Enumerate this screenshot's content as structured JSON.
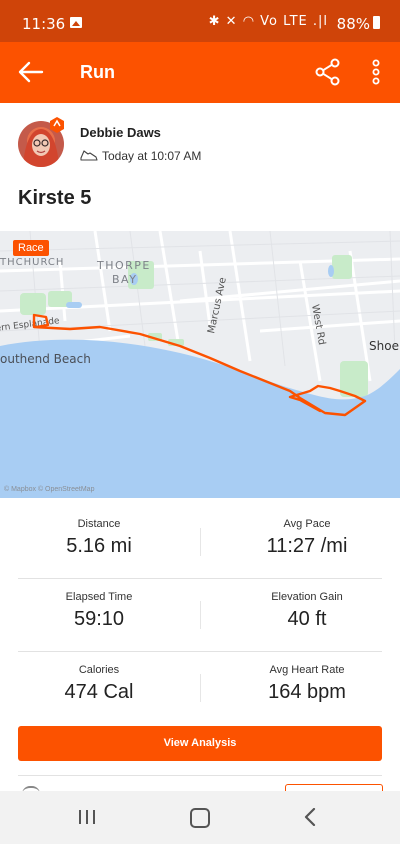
{
  "status_bar": {
    "time": "11:36",
    "icons": "✱ ✕ ◠ Vo LTE .|l",
    "battery": "88%"
  },
  "app_bar": {
    "title": "Run"
  },
  "athlete": {
    "name": "Debbie Daws",
    "time": "Today at 10:07 AM"
  },
  "activity": {
    "title": "Kirste 5"
  },
  "map": {
    "badge": "Race",
    "labels": {
      "thorpe_bay_1": "THORPE",
      "thorpe_bay_2": "BAY",
      "church": "THCHURCH",
      "marcus": "Marcus Ave",
      "west": "West Rd",
      "shoe": "Shoe",
      "esplanade": "ern Esplanade",
      "beach": "outhend Beach"
    },
    "attribution": "© Mapbox © OpenStreetMap"
  },
  "stats": [
    {
      "left": {
        "label": "Distance",
        "value": "5.16 mi"
      },
      "right": {
        "label": "Avg Pace",
        "value": "11:27 /mi"
      }
    },
    {
      "left": {
        "label": "Elapsed Time",
        "value": "59:10"
      },
      "right": {
        "label": "Elevation Gain",
        "value": "40 ft"
      }
    },
    {
      "left": {
        "label": "Calories",
        "value": "474 Cal"
      },
      "right": {
        "label": "Avg Heart Rate",
        "value": "164 bpm"
      }
    }
  ],
  "actions": {
    "view_analysis": "View Analysis"
  },
  "colors": {
    "brand": "#fc5200",
    "status_bar": "#cf4409",
    "water": "#a8cdf3",
    "park": "#c8ebc9",
    "route": "#fc5200"
  }
}
